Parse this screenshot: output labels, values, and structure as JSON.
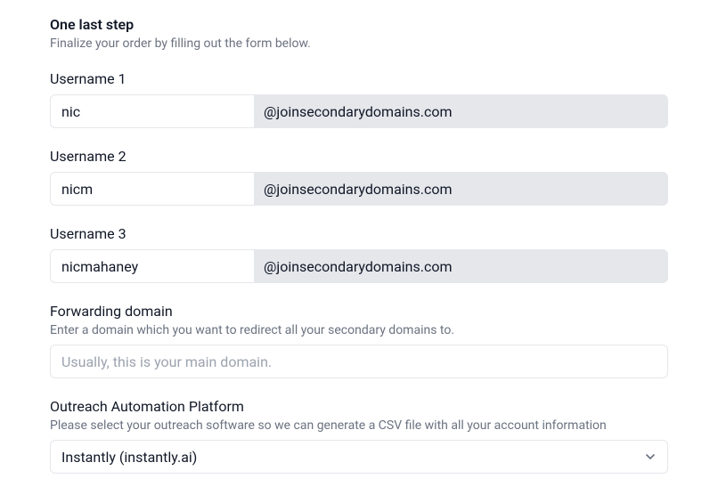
{
  "heading": "One last step",
  "subheading": "Finalize your order by filling out the form below.",
  "usernames": [
    {
      "label": "Username 1",
      "value": "nic",
      "domain": "@joinsecondarydomains.com"
    },
    {
      "label": "Username 2",
      "value": "nicm",
      "domain": "@joinsecondarydomains.com"
    },
    {
      "label": "Username 3",
      "value": "nicmahaney",
      "domain": "@joinsecondarydomains.com"
    }
  ],
  "forwarding": {
    "label": "Forwarding domain",
    "help": "Enter a domain which you want to redirect all your secondary domains to.",
    "placeholder": "Usually, this is your main domain.",
    "value": ""
  },
  "outreach": {
    "label": "Outreach Automation Platform",
    "help": "Please select your outreach software so we can generate a CSV file with all your account information",
    "selected": "Instantly (instantly.ai)"
  }
}
